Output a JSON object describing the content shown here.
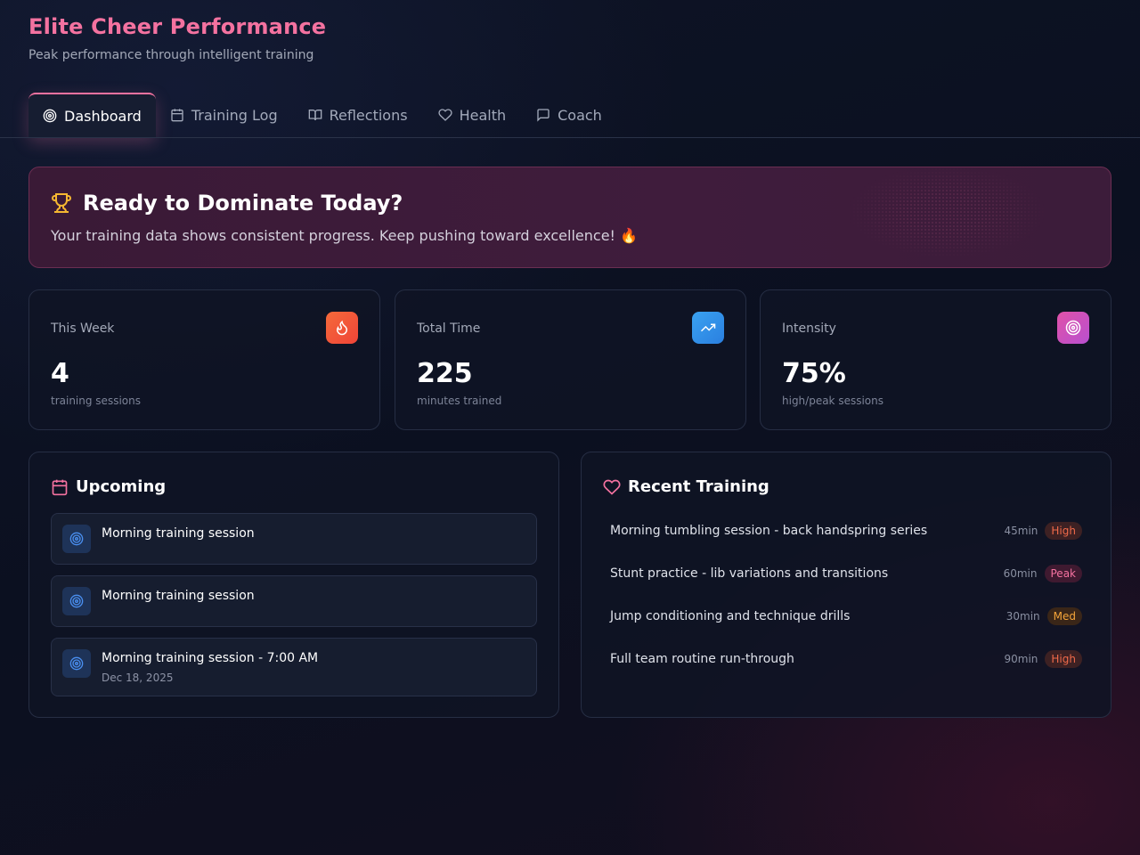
{
  "header": {
    "title": "Elite Cheer Performance",
    "subtitle": "Peak performance through intelligent training"
  },
  "tabs": [
    {
      "label": "Dashboard",
      "icon": "target-icon",
      "active": true
    },
    {
      "label": "Training Log",
      "icon": "calendar-icon",
      "active": false
    },
    {
      "label": "Reflections",
      "icon": "book-icon",
      "active": false
    },
    {
      "label": "Health",
      "icon": "heart-icon",
      "active": false
    },
    {
      "label": "Coach",
      "icon": "chat-icon",
      "active": false
    }
  ],
  "banner": {
    "title": "Ready to Dominate Today?",
    "text": "Your training data shows consistent progress. Keep pushing toward excellence! 🔥",
    "icon": "trophy-icon"
  },
  "stats": [
    {
      "label": "This Week",
      "value": "4",
      "sub": "training sessions",
      "icon": "flame-icon",
      "color": "#f4563a"
    },
    {
      "label": "Total Time",
      "value": "225",
      "sub": "minutes trained",
      "icon": "trending-up-icon",
      "color": "#2f8fe8"
    },
    {
      "label": "Intensity",
      "value": "75%",
      "sub": "high/peak sessions",
      "icon": "target-icon",
      "color": "#d44fb8"
    }
  ],
  "upcoming": {
    "title": "Upcoming",
    "items": [
      {
        "title": "Morning training session",
        "date": ""
      },
      {
        "title": "Morning training session",
        "date": ""
      },
      {
        "title": "Morning training session - 7:00 AM",
        "date": "Dec 18, 2025"
      }
    ]
  },
  "recent": {
    "title": "Recent Training",
    "items": [
      {
        "text": "Morning tumbling session - back handspring series",
        "minutes": "45min",
        "level": "High"
      },
      {
        "text": "Stunt practice - lib variations and transitions",
        "minutes": "60min",
        "level": "Peak"
      },
      {
        "text": "Jump conditioning and technique drills",
        "minutes": "30min",
        "level": "Med"
      },
      {
        "text": "Full team routine run-through",
        "minutes": "90min",
        "level": "High"
      }
    ]
  },
  "colors": {
    "accent": "#f472a0",
    "high_badge_bg": "#3d2123",
    "high_badge_fg": "#f06a4a",
    "peak_badge_bg": "#3f1a30",
    "peak_badge_fg": "#f472a0",
    "med_badge_bg": "#3a2618",
    "med_badge_fg": "#f5a53a"
  }
}
